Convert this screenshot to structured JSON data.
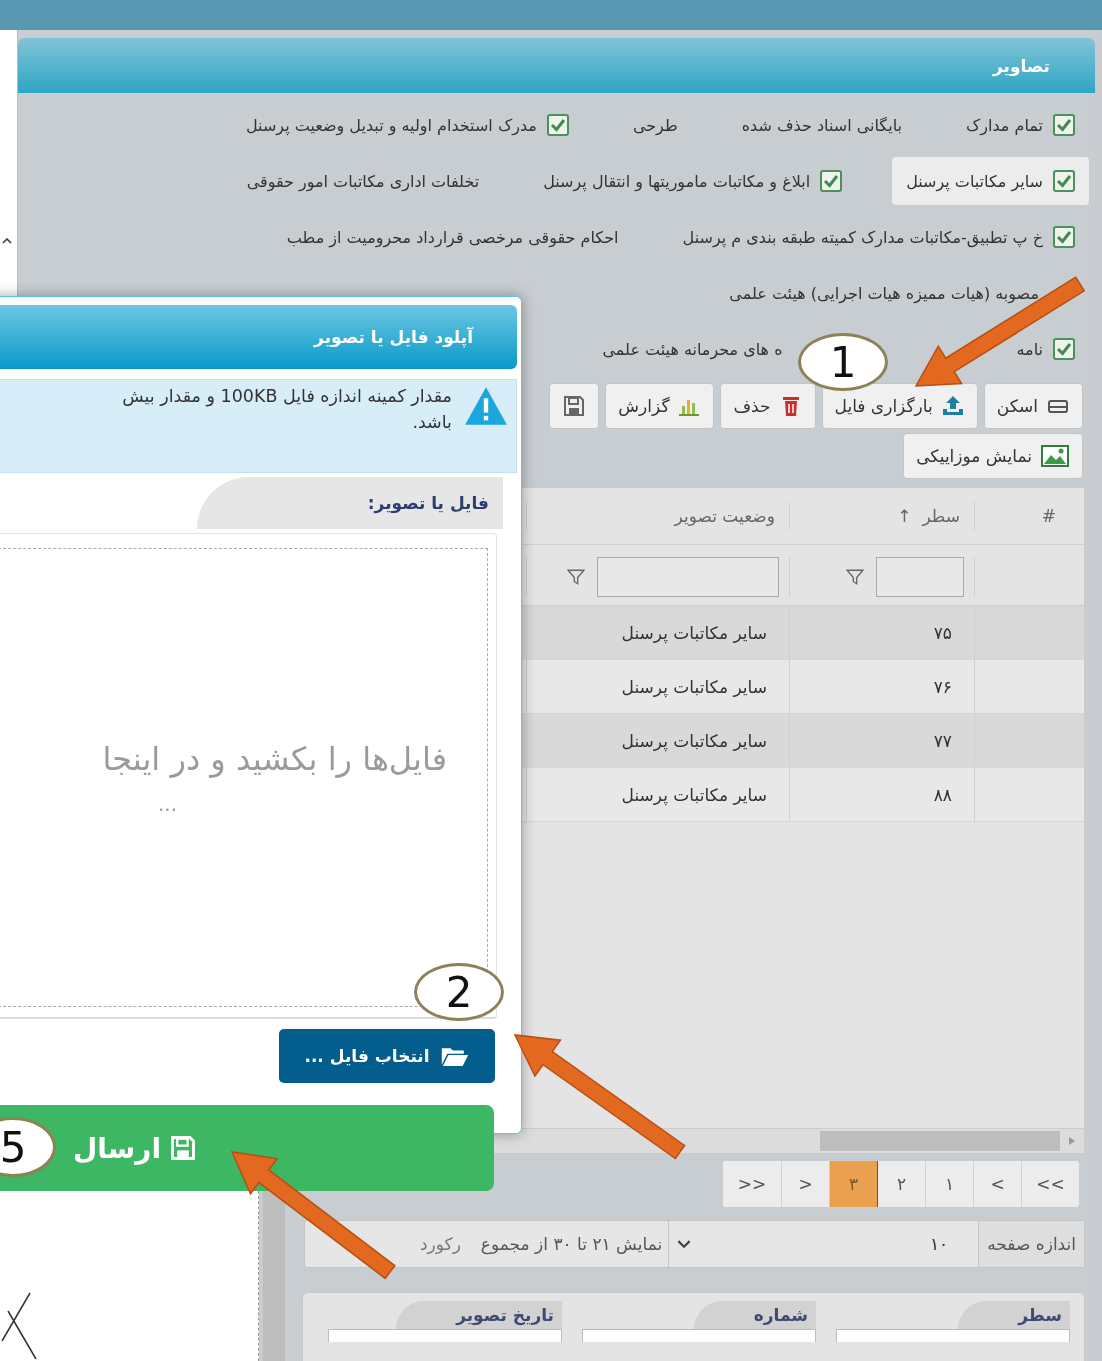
{
  "page_header": {
    "title": "تصاویر"
  },
  "filter_rows": [
    {
      "items": [
        {
          "label": "تمام مدارک",
          "checked": true,
          "selected": false
        },
        {
          "label": "بایگانی اسناد حذف شده",
          "checked": false,
          "selected": false
        },
        {
          "label": "طرحی",
          "checked": false,
          "selected": false
        },
        {
          "label": "مدرک استخدام اولیه و تبدیل وضعیت پرسنل",
          "checked": true,
          "selected": false
        }
      ]
    },
    {
      "items": [
        {
          "label": "سایر مکاتبات پرسنل",
          "checked": true,
          "selected": true
        },
        {
          "label": "ابلاغ و مکاتبات ماموریتها و انتقال پرسنل",
          "checked": true,
          "selected": false
        },
        {
          "label": "تخلفات اداری مکاتبات امور حقوقی",
          "checked": false,
          "selected": false
        }
      ]
    },
    {
      "items": [
        {
          "label": "خ پ تطبیق-مکاتبات مدارک کمیته طبقه بندی م پرسنل",
          "checked": true,
          "selected": false
        },
        {
          "label": "احکام حقوقی مرخصی قرارداد محرومیت از مطب",
          "checked": false,
          "selected": false
        }
      ]
    },
    {
      "items": [
        {
          "label": "مصوبه (هیات ممیزه هیات اجرایی) هیئت علمی",
          "checked": false,
          "selected": false
        }
      ]
    },
    {
      "items": [
        {
          "label": "نامه",
          "checked": true,
          "selected": false
        },
        {
          "label": "ه های محرمانه هیئت علمی",
          "checked": false,
          "selected": false
        }
      ]
    }
  ],
  "toolbar": {
    "rows": [
      {
        "buttons": [
          {
            "kind": "scan",
            "label": "اسکن"
          },
          {
            "kind": "upload",
            "label": "بارگزاری فایل"
          },
          {
            "kind": "delete",
            "label": "حذف"
          },
          {
            "kind": "report",
            "label": "گزارش"
          },
          {
            "kind": "save"
          }
        ]
      },
      {
        "buttons": [
          {
            "kind": "mosaic",
            "label": "نمایش موزاییکی"
          }
        ]
      }
    ]
  },
  "grid": {
    "columns": [
      {
        "label": "#",
        "filter": false
      },
      {
        "label": "سطر",
        "sort": "↑",
        "filter": true
      },
      {
        "label": "وضعیت تصویر",
        "filter": true
      }
    ],
    "rows": [
      {
        "row": "۷۵",
        "status": "سایر مکاتبات پرسنل"
      },
      {
        "row": "۷۶",
        "status": "سایر مکاتبات پرسنل"
      },
      {
        "row": "۷۷",
        "status": "سایر مکاتبات پرسنل"
      },
      {
        "row": "۸۸",
        "status": "سایر مکاتبات پرسنل"
      }
    ]
  },
  "pagination": {
    "pages": [
      {
        "label": ">>",
        "selected": false
      },
      {
        "label": ">",
        "selected": false
      },
      {
        "label": "۱",
        "selected": false
      },
      {
        "label": "۲",
        "selected": false
      },
      {
        "label": "۳",
        "selected": true
      },
      {
        "label": "<",
        "selected": false
      },
      {
        "label": "<<",
        "selected": false
      }
    ]
  },
  "page_size": {
    "label": "اندازه صفحه",
    "value": "۱۰",
    "info": "نمایش ۲۱ تا ۳۰ از مجموع",
    "info_end": "رکورد"
  },
  "detail_form": {
    "fields": [
      {
        "label": "سطر"
      },
      {
        "label": "شماره"
      },
      {
        "label": "تاریخ تصویر"
      }
    ]
  },
  "upload_dialog": {
    "title": "آپلود فایل یا تصویر",
    "warning_lines": [
      "مقدار کمینه اندازه فایل 100KB و مقدار بیش",
      "باشد."
    ],
    "field_label": "فایل یا تصویر:",
    "dropzone_text": "فایل‌ها را بکشید و در اینجا",
    "dropzone_more": "...",
    "choose_button": "انتخاب فایل ...",
    "submit_button": "ارسال"
  },
  "callouts": [
    {
      "label": "1"
    },
    {
      "label": "2"
    },
    {
      "label": "5"
    }
  ]
}
